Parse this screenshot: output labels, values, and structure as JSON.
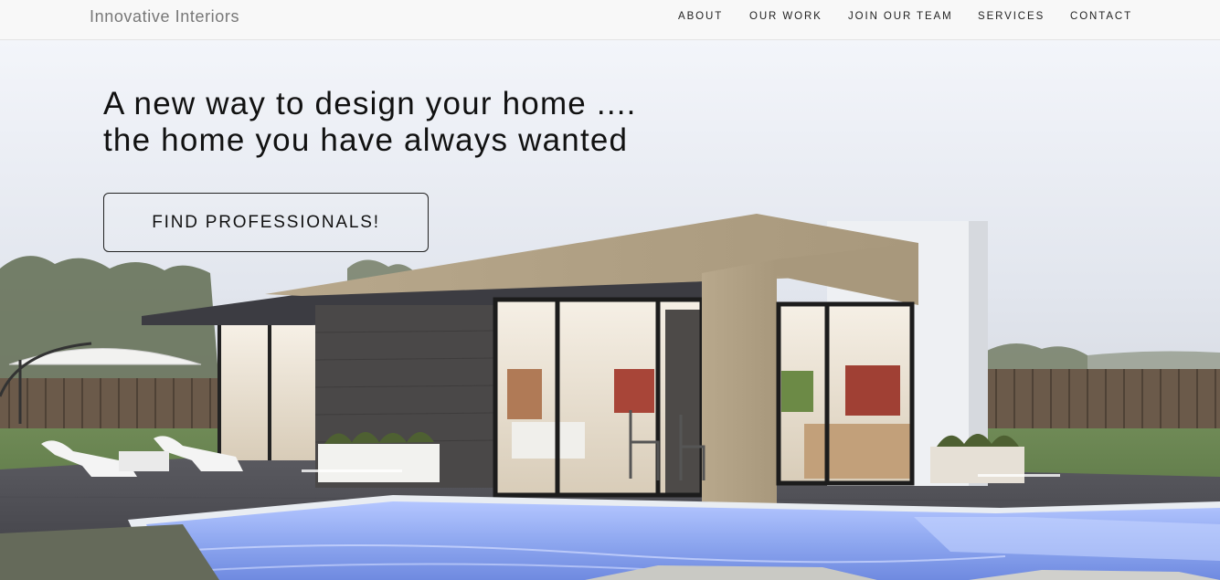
{
  "navbar": {
    "brand": "Innovative Interiors",
    "links": [
      {
        "label": "ABOUT"
      },
      {
        "label": "OUR WORK"
      },
      {
        "label": "JOIN OUR TEAM"
      },
      {
        "label": "SERVICES"
      },
      {
        "label": "CONTACT"
      }
    ]
  },
  "hero": {
    "headline_line1": "A new way to design your home ....",
    "headline_line2": "the home you have always wanted",
    "cta_label": "FIND PROFESSIONALS!"
  },
  "colors": {
    "navbar_bg": "#f8f8f8",
    "brand_text": "#777777",
    "nav_text": "#222222",
    "headline_text": "#111111",
    "pool_water": "#8fa8f0"
  }
}
